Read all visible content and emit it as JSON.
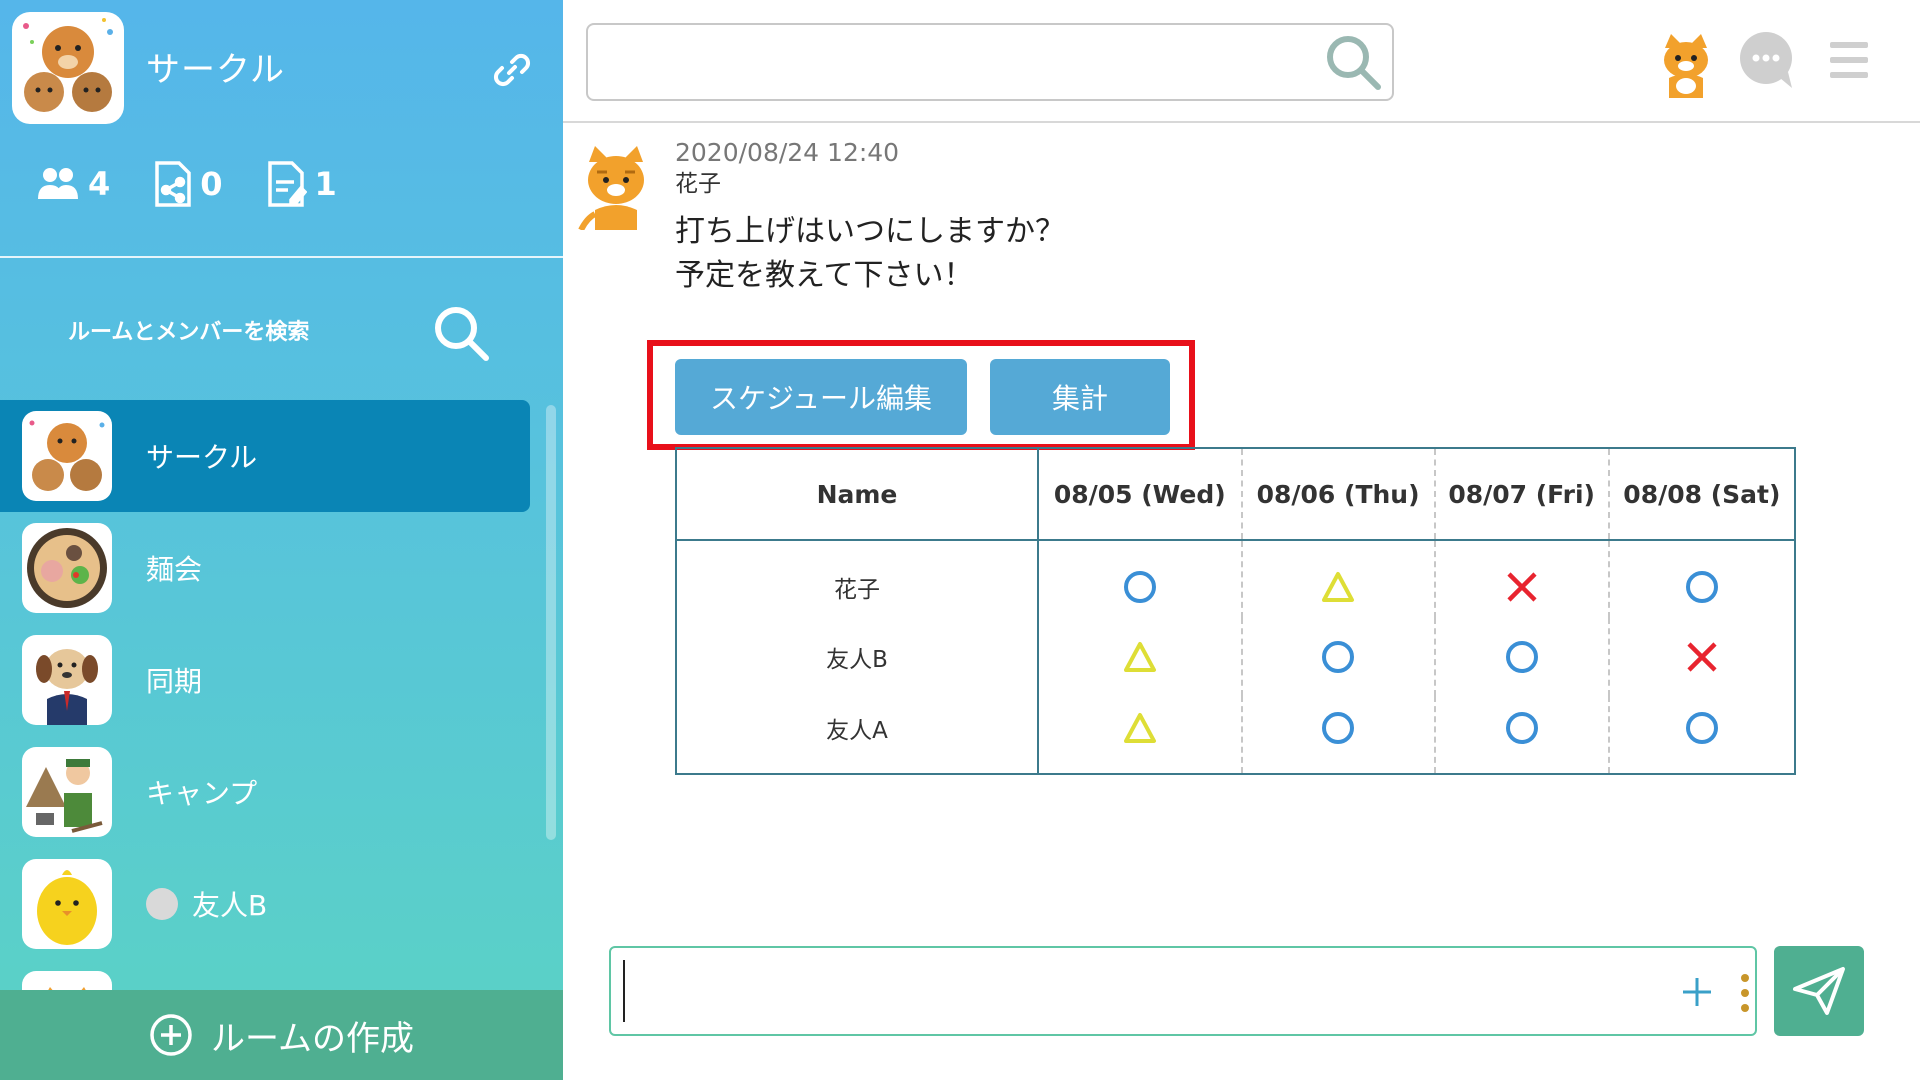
{
  "sidebar": {
    "group": {
      "title": "サークル",
      "stats": [
        {
          "icon": "members-icon",
          "count": "4"
        },
        {
          "icon": "shared-file-icon",
          "count": "0"
        },
        {
          "icon": "note-icon",
          "count": "1"
        }
      ]
    },
    "search_label": "ルームとメンバーを検索",
    "rooms": [
      {
        "name": "サークル",
        "active": true
      },
      {
        "name": "麺会",
        "active": false
      },
      {
        "name": "同期",
        "active": false
      },
      {
        "name": "キャンプ",
        "active": false
      },
      {
        "name": "友人B",
        "active": false,
        "status": "offline"
      }
    ],
    "create_room_label": "ルームの作成"
  },
  "header": {
    "search": {
      "value": "",
      "placeholder": ""
    }
  },
  "message": {
    "time": "2020/08/24 12:40",
    "user": "花子",
    "lines": [
      "打ち上げはいつにしますか？",
      "予定を教えて下さい！"
    ]
  },
  "actions": {
    "edit_schedule": "スケジュール編集",
    "tally": "集計"
  },
  "schedule": {
    "headers": [
      "Name",
      "08/05 (Wed)",
      "08/06 (Thu)",
      "08/07 (Fri)",
      "08/08 (Sat)"
    ],
    "rows": [
      {
        "name": "花子",
        "marks": [
          "circle",
          "triangle",
          "cross",
          "circle"
        ]
      },
      {
        "name": "友人B",
        "marks": [
          "triangle",
          "circle",
          "circle",
          "cross"
        ]
      },
      {
        "name": "友人A",
        "marks": [
          "triangle",
          "circle",
          "circle",
          "circle"
        ]
      }
    ]
  },
  "composer": {
    "value": "",
    "placeholder": ""
  },
  "colors": {
    "accent_blue": "#55a9d6",
    "active_room": "#0a85b5",
    "green": "#4faf91",
    "highlight_red": "#e8101a",
    "mark_circle": "#3a8fd6",
    "mark_triangle": "#dede36",
    "mark_cross": "#e8242f"
  }
}
